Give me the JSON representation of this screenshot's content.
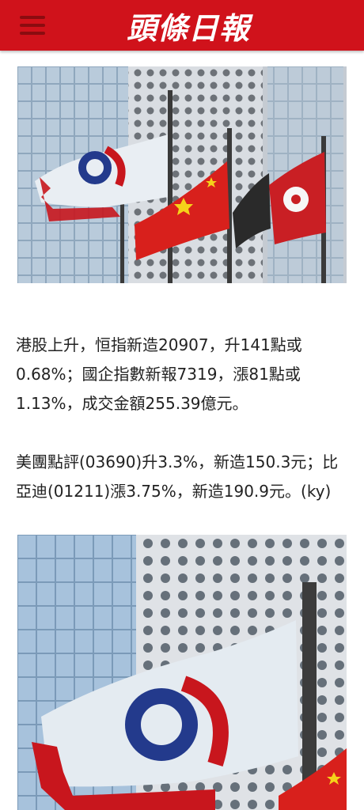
{
  "header": {
    "logo_text": "頭條日報",
    "menu_icon": "hamburger-menu-icon",
    "background_color": "#d0121b"
  },
  "article": {
    "paragraphs": [
      "港股上升，恒指新造20907，升141點或0.68%；國企指數新報7319，漲81點或1.13%，成交金額255.39億元。",
      "美團點評(03690)升3.3%，新造150.3元；比亞迪(01211)漲3.75%，新造190.9元。(ky)"
    ]
  }
}
